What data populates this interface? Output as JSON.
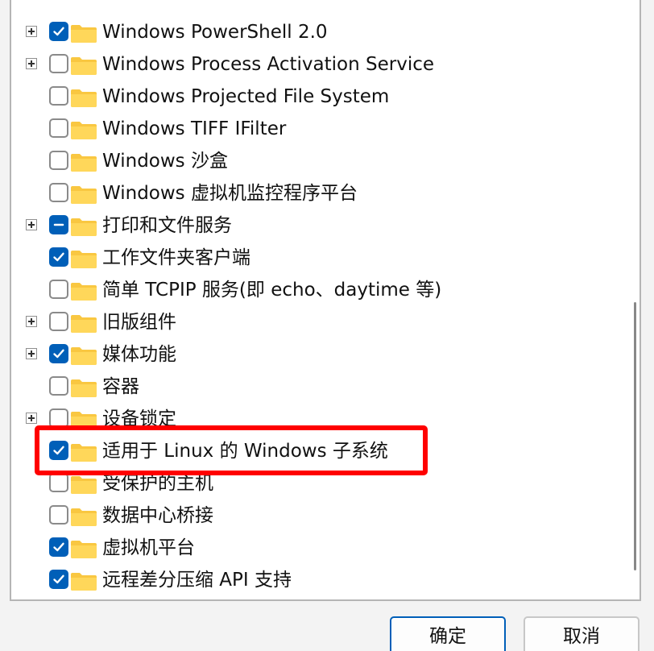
{
  "features": [
    {
      "label": "Windows PowerShell 2.0",
      "state": "checked",
      "expandable": true
    },
    {
      "label": "Windows Process Activation Service",
      "state": "unchecked",
      "expandable": true
    },
    {
      "label": "Windows Projected File System",
      "state": "unchecked",
      "expandable": false
    },
    {
      "label": "Windows TIFF IFilter",
      "state": "unchecked",
      "expandable": false
    },
    {
      "label": "Windows 沙盒",
      "state": "unchecked",
      "expandable": false
    },
    {
      "label": "Windows 虚拟机监控程序平台",
      "state": "unchecked",
      "expandable": false
    },
    {
      "label": "打印和文件服务",
      "state": "partial",
      "expandable": true
    },
    {
      "label": "工作文件夹客户端",
      "state": "checked",
      "expandable": false
    },
    {
      "label": "简单 TCPIP 服务(即 echo、daytime 等)",
      "state": "unchecked",
      "expandable": false
    },
    {
      "label": "旧版组件",
      "state": "unchecked",
      "expandable": true
    },
    {
      "label": "媒体功能",
      "state": "checked",
      "expandable": true
    },
    {
      "label": "容器",
      "state": "unchecked",
      "expandable": false
    },
    {
      "label": "设备锁定",
      "state": "unchecked",
      "expandable": true
    },
    {
      "label": "适用于 Linux 的 Windows 子系统",
      "state": "checked",
      "expandable": false,
      "highlighted": true
    },
    {
      "label": "受保护的主机",
      "state": "unchecked",
      "expandable": false
    },
    {
      "label": "数据中心桥接",
      "state": "unchecked",
      "expandable": false
    },
    {
      "label": "虚拟机平台",
      "state": "checked",
      "expandable": false
    },
    {
      "label": "远程差分压缩 API 支持",
      "state": "checked",
      "expandable": false
    }
  ],
  "buttons": {
    "ok": "确定",
    "cancel": "取消"
  },
  "colors": {
    "checkbox_accent": "#005fb8",
    "folder": "#f9c741",
    "highlight": "#ff0000"
  },
  "icons": {
    "expand": "plus-expander-icon",
    "folder": "folder-icon",
    "checked": "checkmark-icon",
    "partial": "indeterminate-icon"
  }
}
